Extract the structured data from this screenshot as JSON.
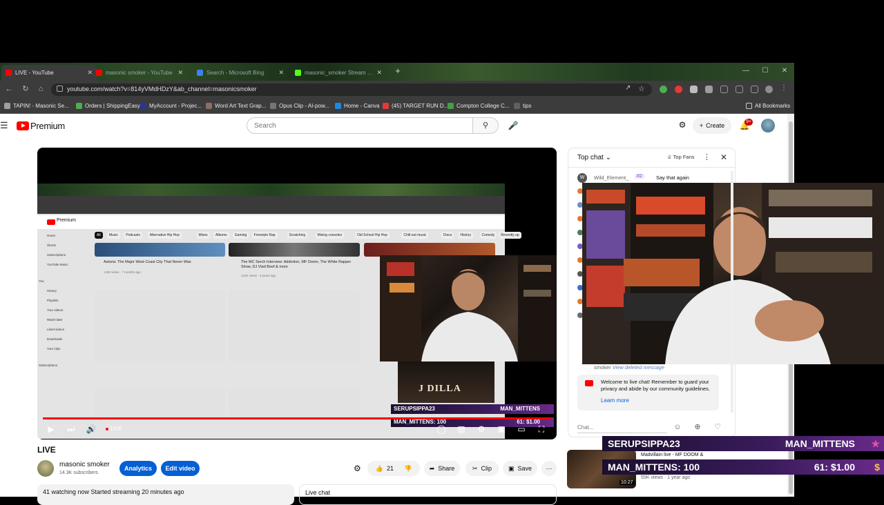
{
  "browser": {
    "tabs": [
      {
        "title": "LIVE - YouTube",
        "active": true,
        "color": "#ff0000"
      },
      {
        "title": "masonic smoker - YouTube",
        "active": false,
        "color": "#ff0000"
      },
      {
        "title": "Search - Microsoft Bing",
        "active": false,
        "color": "#3b82f6"
      },
      {
        "title": "masonic_smoker Stream - Wat",
        "active": false,
        "color": "#53fc18"
      }
    ],
    "url": "youtube.com/watch?v=814yVMdHDzY&ab_channel=masonicsmoker",
    "bookmarks": [
      "TAPIN! - Masonic Se...",
      "Orders | ShippingEasy",
      "MyAccount - Projec...",
      "Word Art Text Grap...",
      "Opus Clip - AI-pow...",
      "Home - Canva",
      "(45) TARGET RUN D...",
      "Compton College C...",
      "tips"
    ],
    "all_bookmarks": "All Bookmarks"
  },
  "youtube": {
    "brand": "Premium",
    "search_placeholder": "Search",
    "create_label": "Create",
    "notif_count": "9+"
  },
  "inner_screen": {
    "brand": "Premium",
    "chips": [
      "All",
      "Music",
      "Podcasts",
      "Alternative Hip Hop",
      "Mixes",
      "Albums",
      "Gaming",
      "Freestyle Rap",
      "Scratching",
      "Mixing consoles",
      "Old School Hip Hop",
      "Chill-out music",
      "Disco",
      "History",
      "Comedy",
      "Recently up"
    ],
    "videos": [
      {
        "title": "Astoria: The Major West Coast City That Never Was",
        "meta": "1.8M views · 7 months ago"
      },
      {
        "title": "The MC Serch Interview: Addiction, MF Doom, The White Rapper Show, DJ Vlad Beef & more",
        "meta": "131K views · 3 years ago"
      }
    ],
    "side_links": [
      "Home",
      "Shorts",
      "Subscriptions",
      "YouTube Music",
      "You",
      "History",
      "Playlists",
      "Your videos",
      "Watch later",
      "Liked videos",
      "Downloads",
      "Your clips",
      "Subscriptions"
    ]
  },
  "overlay": {
    "jdilla": "J DILLA",
    "user1": "SERUPSIPPA23",
    "user2": "MAN_MITTENS",
    "donation_line": "MAN_MITTENS: 100",
    "amount_line": "61: $1.00"
  },
  "player": {
    "live_label": "LIVE"
  },
  "video": {
    "title": "LIVE",
    "channel": "masonic smoker",
    "subscribers": "14.3K subscribers",
    "analytics_label": "Analytics",
    "edit_label": "Edit video",
    "likes": "21",
    "share_label": "Share",
    "clip_label": "Clip",
    "save_label": "Save",
    "watching": "41 watching now  Started streaming 20 minutes ago",
    "live_chat_label": "Live chat"
  },
  "chat": {
    "header": "Top chat",
    "top_fans": "Top Fans",
    "first_author": "Wild_Element_",
    "first_badge": "#2",
    "first_text": "Say that again",
    "first_avatar_letter": "W",
    "deleted_author": "smoker",
    "deleted_text": "View deleted message",
    "welcome": "Welcome to live chat! Remember to guard your privacy and abide by our community guidelines.",
    "learn_more": "Learn more",
    "input_placeholder": "Chat...",
    "avatar_colors": [
      "#e8772e",
      "#6b8fbf",
      "#e8772e",
      "#4a7d5c",
      "#7a5ac9",
      "#e8772e",
      "#555555",
      "#3b6fd1",
      "#e8772e",
      "#6b6b6b"
    ]
  },
  "recommended": {
    "title": "Madvillain live - MF DOOM &",
    "meta": "55K views · 1 year ago",
    "duration": "10:27"
  },
  "colors": {
    "yt_red": "#ff0000",
    "link_blue": "#065fd4",
    "chrome_dark": "#3c3c3c"
  }
}
